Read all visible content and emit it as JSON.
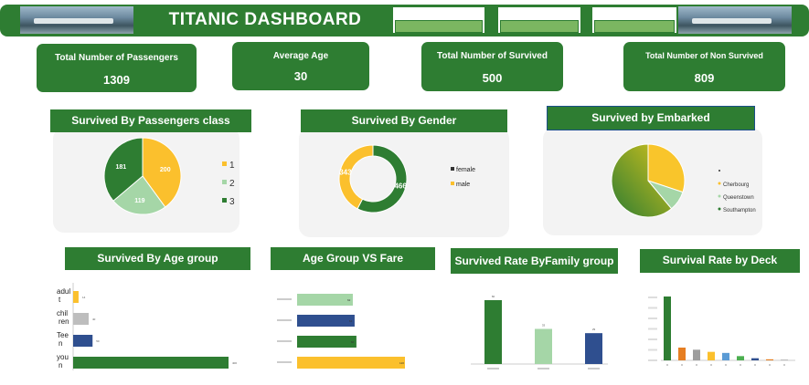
{
  "header": {
    "title": "TITANIC DASHBOARD"
  },
  "kpis": [
    {
      "label": "Total  Number of Passengers",
      "value": "1309"
    },
    {
      "label": "Average Age",
      "value": "30"
    },
    {
      "label": "Total  Number of Survived",
      "value": "500"
    },
    {
      "label": "Total  Number of Non Survived",
      "value": "809"
    }
  ],
  "panels": {
    "pclass": "Survived By Passengers class",
    "gender": "Survived By  Gender",
    "embarked": "Survived by Embarked",
    "agegroup": "Survived By Age group",
    "agefare": "Age Group VS Fare",
    "family": "Survived Rate ByFamily group",
    "deck": "Survival Rate by Deck"
  },
  "colors": {
    "green": "#2e7d32",
    "yellow": "#fbc02d",
    "light_green": "#a5d6a7",
    "blue": "#2f4f8f",
    "grey": "#bdbdbd",
    "orange": "#e67e22"
  },
  "chart_data": [
    {
      "id": "pclass",
      "type": "pie",
      "categories": [
        "1",
        "2",
        "3"
      ],
      "values": [
        200,
        119,
        181
      ],
      "legend": "right"
    },
    {
      "id": "gender",
      "type": "pie",
      "donut": true,
      "categories": [
        "female",
        "male"
      ],
      "values": [
        466,
        343
      ],
      "legend": "right"
    },
    {
      "id": "embarked",
      "type": "pie",
      "categories": [
        "Cherbourg",
        "Queenstown",
        "Southampton"
      ],
      "values": [
        150,
        44,
        304
      ],
      "legend": "right"
    },
    {
      "id": "agegroup",
      "type": "bar",
      "orientation": "horizontal",
      "categories": [
        "adult",
        "children",
        "Teen",
        "young"
      ],
      "tick_labels": [
        [
          "adul",
          "t"
        ],
        [
          "chil",
          "ren"
        ],
        [
          "Tee",
          "n"
        ],
        [
          "you",
          "n"
        ]
      ],
      "values": [
        14,
        40,
        50,
        400
      ]
    },
    {
      "id": "agefare",
      "type": "bar",
      "orientation": "horizontal",
      "values": [
        62,
        64,
        66,
        120
      ]
    },
    {
      "id": "family",
      "type": "bar",
      "values": [
        60,
        33,
        29
      ]
    },
    {
      "id": "deck",
      "type": "bar",
      "values": [
        60,
        12,
        10,
        8,
        7,
        4,
        2,
        1,
        0.5
      ]
    }
  ]
}
